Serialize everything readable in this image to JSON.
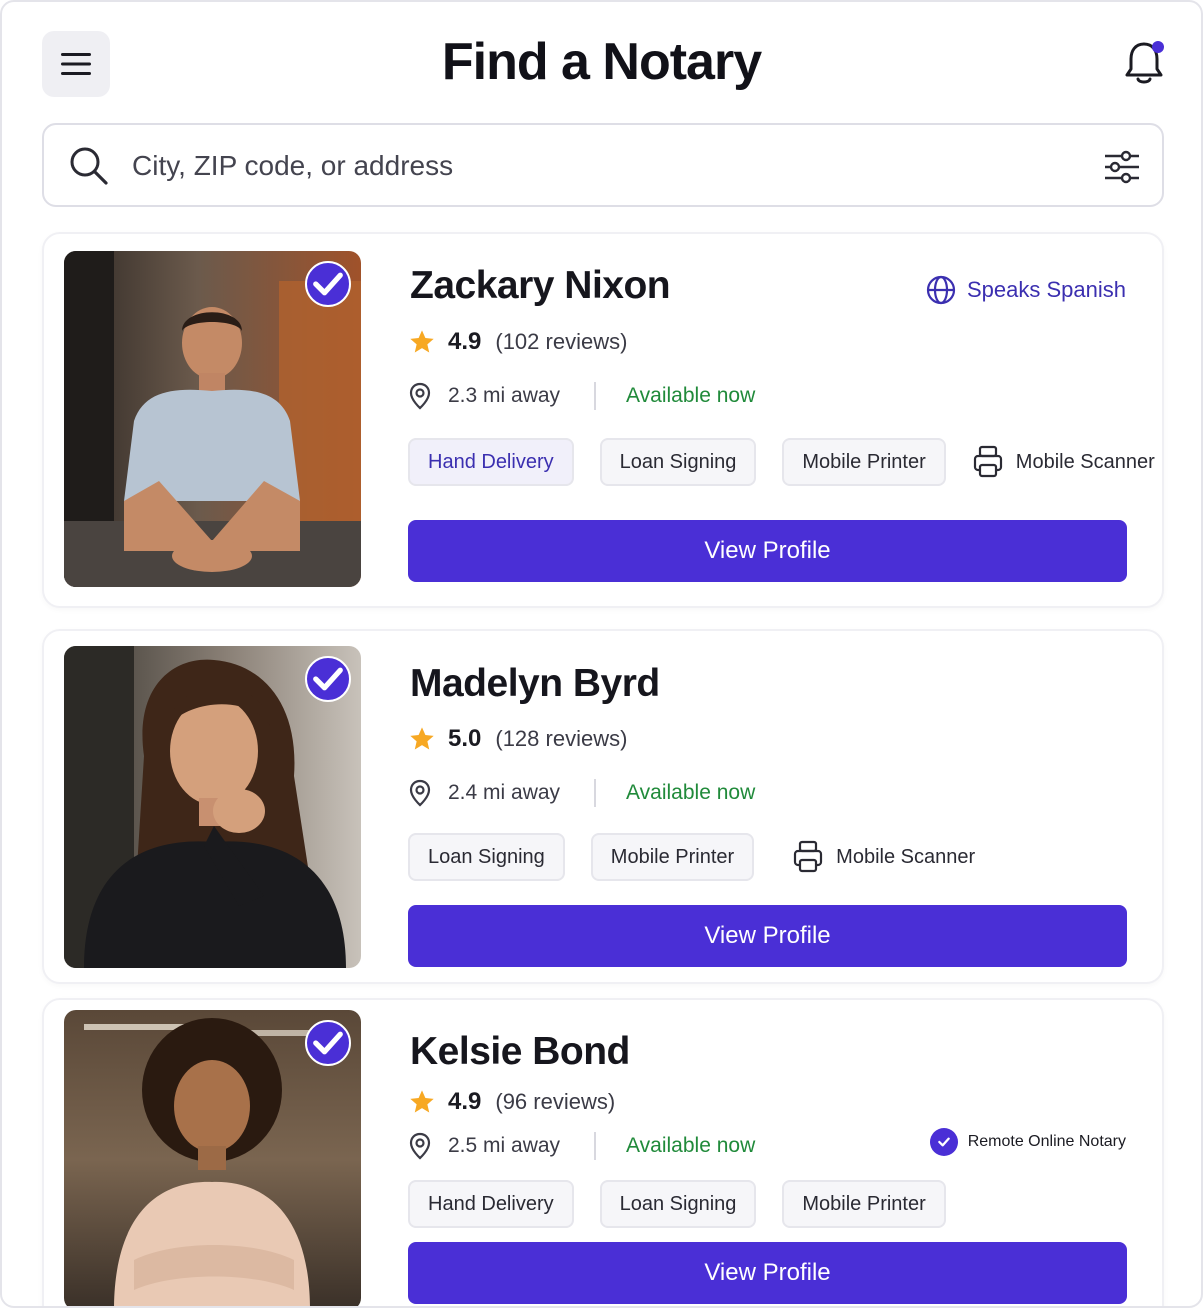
{
  "header": {
    "title": "Find a Notary",
    "menu_icon": "hamburger-menu-icon",
    "notification_icon": "bell-icon"
  },
  "search": {
    "placeholder": "City, ZIP code, or address",
    "value": ""
  },
  "colors": {
    "accent": "#4a2fd6",
    "available": "#208a3a",
    "star": "#f7a823"
  },
  "notaries": [
    {
      "name": "Zackary Nixon",
      "rating": "4.9",
      "reviews": "(102 reviews)",
      "distance": "2.3 mi away",
      "availability": "Available now",
      "language": "Speaks Spanish",
      "tags": [
        "Hand Delivery",
        "Loan Signing",
        "Mobile Printer"
      ],
      "extra_tag": "Mobile Scanner",
      "button": "View Profile"
    },
    {
      "name": "Madelyn Byrd",
      "rating": "5.0",
      "reviews": "(128 reviews)",
      "distance": "2.4 mi away",
      "availability": "Available now",
      "tags": [
        "Loan Signing",
        "Mobile Printer"
      ],
      "extra_tag": "Mobile Scanner",
      "button": "View Profile"
    },
    {
      "name": "Kelsie Bond",
      "rating": "4.9",
      "reviews": "(96 reviews)",
      "distance": "2.5 mi away",
      "availability": "Available now",
      "badge": "Remote Online Notary",
      "tags": [
        "Hand Delivery",
        "Loan Signing",
        "Mobile Printer"
      ],
      "button": "View Profile"
    }
  ]
}
